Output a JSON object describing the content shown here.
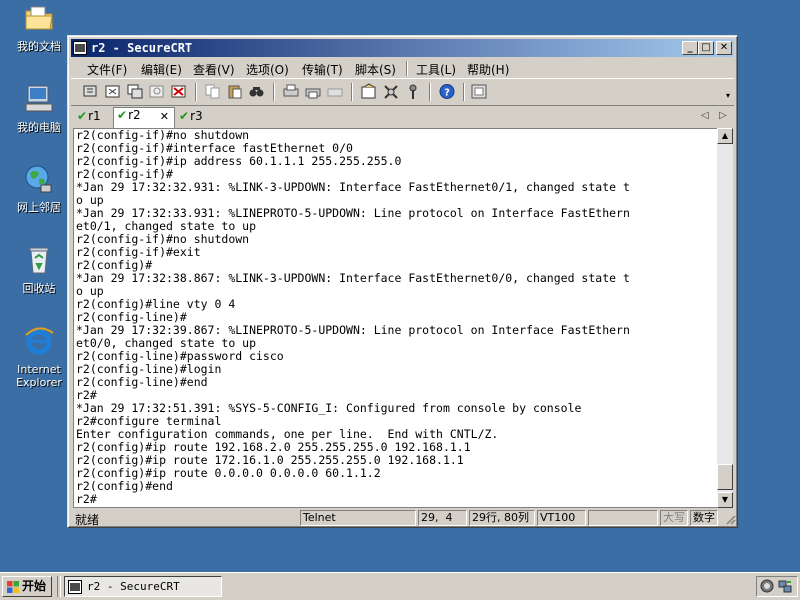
{
  "desktop": {
    "icons": [
      {
        "label": "我的文档"
      },
      {
        "label": "我的电脑"
      },
      {
        "label": "网上邻居"
      },
      {
        "label": "回收站"
      },
      {
        "label": "Internet Explorer"
      }
    ]
  },
  "window": {
    "title": "r2 - SecureCRT",
    "controls": {
      "minimize": "_",
      "maximize": "□",
      "close": "✕"
    }
  },
  "menu": {
    "items": [
      "文件(F)",
      "编辑(E)",
      "查看(V)",
      "选项(O)",
      "传输(T)",
      "脚本(S)",
      "工具(L)",
      "帮助(H)"
    ]
  },
  "tabs": [
    {
      "label": "r1",
      "active": false
    },
    {
      "label": "r2",
      "active": true,
      "close": "✕"
    },
    {
      "label": "r3",
      "active": false
    }
  ],
  "terminal": {
    "lines": "r2(config-if)#no shutdown\nr2(config-if)#interface fastEthernet 0/0\nr2(config-if)#ip address 60.1.1.1 255.255.255.0\nr2(config-if)#\n*Jan 29 17:32:32.931: %LINK-3-UPDOWN: Interface FastEthernet0/1, changed state t\no up\n*Jan 29 17:32:33.931: %LINEPROTO-5-UPDOWN: Line protocol on Interface FastEthern\net0/1, changed state to up\nr2(config-if)#no shutdown\nr2(config-if)#exit\nr2(config)#\n*Jan 29 17:32:38.867: %LINK-3-UPDOWN: Interface FastEthernet0/0, changed state t\no up\nr2(config)#line vty 0 4\nr2(config-line)#\n*Jan 29 17:32:39.867: %LINEPROTO-5-UPDOWN: Line protocol on Interface FastEthern\net0/0, changed state to up\nr2(config-line)#password cisco\nr2(config-line)#login\nr2(config-line)#end\nr2#\n*Jan 29 17:32:51.391: %SYS-5-CONFIG_I: Configured from console by console\nr2#configure terminal\nEnter configuration commands, one per line.  End with CNTL/Z.\nr2(config)#ip route 192.168.2.0 255.255.255.0 192.168.1.1\nr2(config)#ip route 172.16.1.0 255.255.255.0 192.168.1.1\nr2(config)#ip route 0.0.0.0 0.0.0.0 60.1.1.2\nr2(config)#end\nr2#"
  },
  "status": {
    "ready": "就绪",
    "protocol": "Telnet",
    "cursor": "29,  4",
    "size": "29行, 80列",
    "emulation": "VT100",
    "caps": "大写",
    "num": "数字"
  },
  "taskbar": {
    "start": "开始",
    "task": "r2 - SecureCRT"
  },
  "colors": {
    "desktop": "#3a6ea5",
    "title_start": "#0a246a",
    "title_end": "#a6caf0",
    "chrome": "#d4d0c8"
  }
}
